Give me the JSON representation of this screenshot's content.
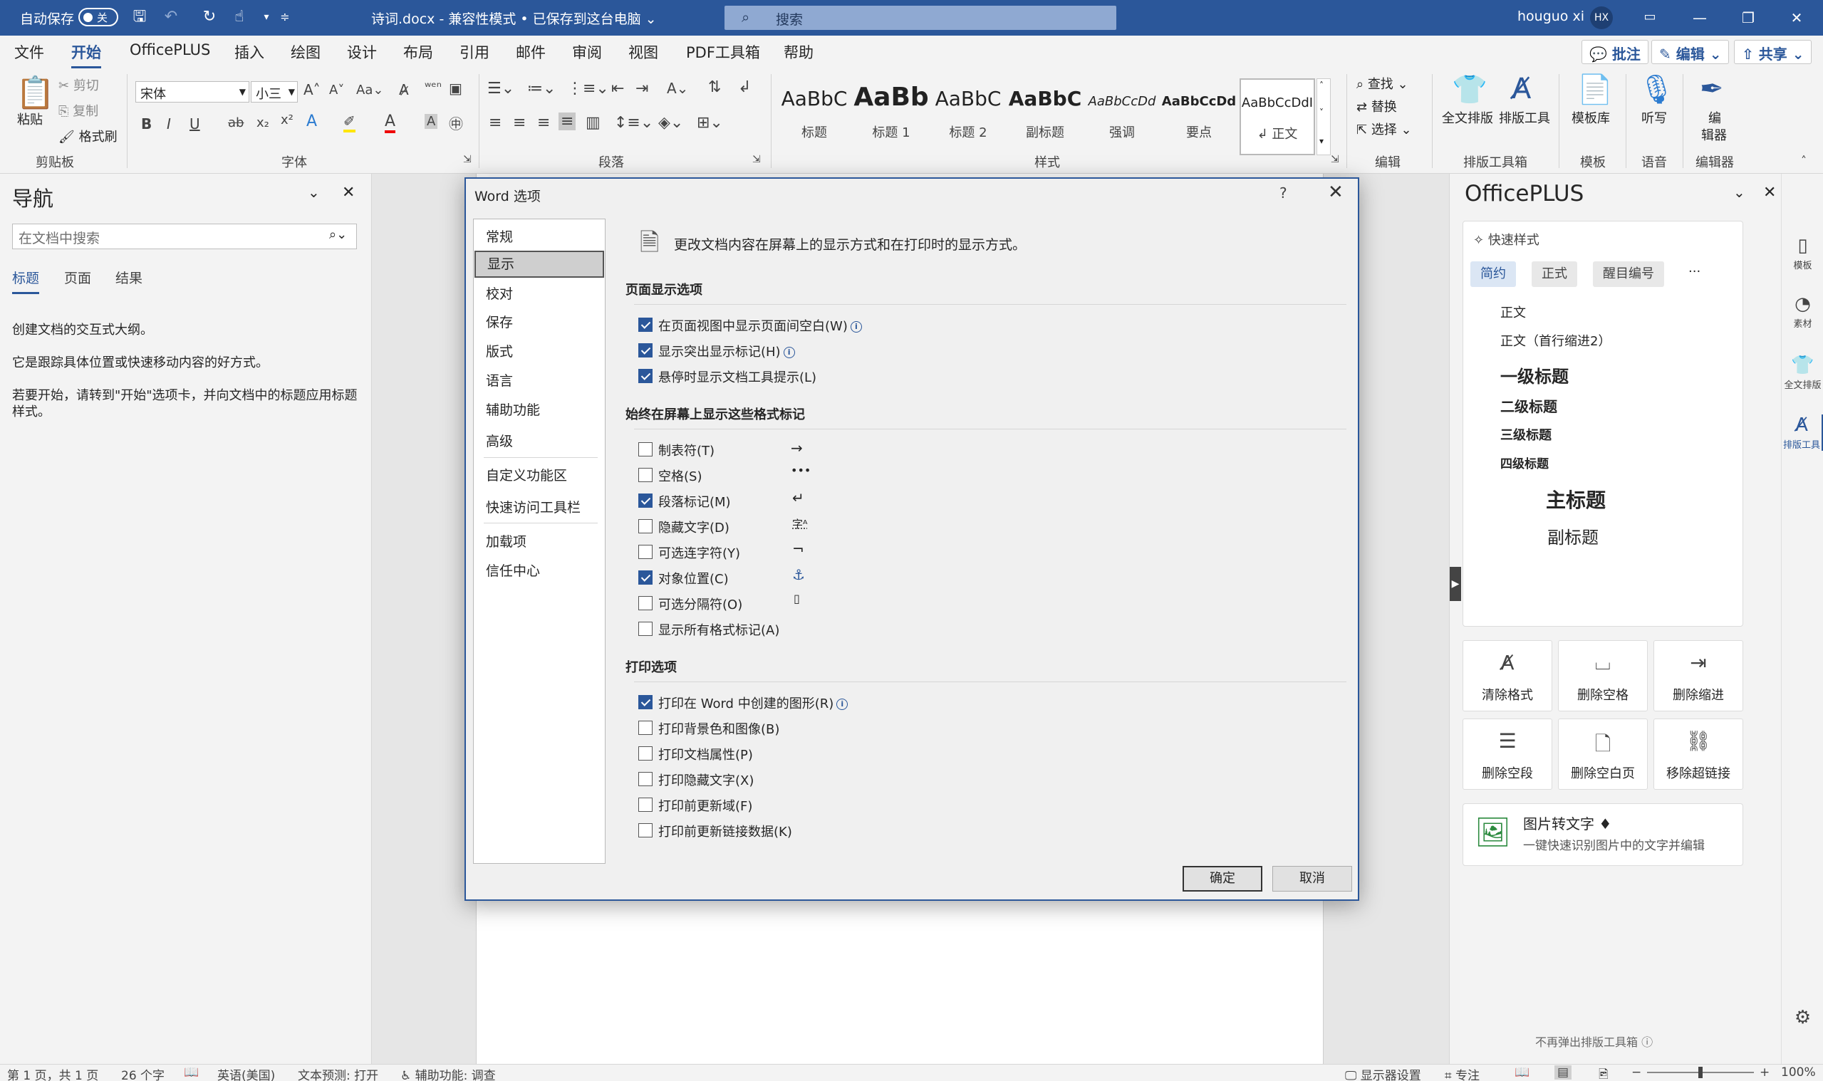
{
  "titlebar": {
    "autosave_label": "自动保存",
    "autosave_state": "关",
    "doc_title": "诗词.docx  -  兼容性模式 • 已保存到这台电脑 ⌄",
    "search_placeholder": "搜索",
    "user_name": "houguo xi",
    "user_initials": "HX",
    "accent_color": "#2b579a"
  },
  "tabs": [
    "文件",
    "开始",
    "OfficePLUS",
    "插入",
    "绘图",
    "设计",
    "布局",
    "引用",
    "邮件",
    "审阅",
    "视图",
    "PDF工具箱",
    "帮助"
  ],
  "active_tab": "开始",
  "ribbon_actions": {
    "comment": "批注",
    "edit": "编辑",
    "share": "共享"
  },
  "ribbon": {
    "clipboard": {
      "paste": "粘贴",
      "cut": "剪切",
      "copy": "复制",
      "format_painter": "格式刷",
      "group": "剪贴板"
    },
    "font": {
      "name": "宋体",
      "size": "小三",
      "group": "字体"
    },
    "paragraph": {
      "group": "段落"
    },
    "styles": {
      "items": [
        {
          "preview": "AaBbC",
          "name": "标题"
        },
        {
          "preview": "AaBb",
          "name": "标题 1"
        },
        {
          "preview": "AaBbC",
          "name": "标题 2"
        },
        {
          "preview": "AaBbC",
          "name": "副标题"
        },
        {
          "preview": "AaBbCcDd",
          "name": "强调"
        },
        {
          "preview": "AaBbCcDd",
          "name": "要点"
        },
        {
          "preview": "AaBbCcDdI",
          "name": "↲ 正文"
        }
      ],
      "group": "样式"
    },
    "editing": {
      "find": "查找",
      "replace": "替换",
      "select": "选择",
      "group": "编辑"
    },
    "layout_tools": {
      "full": "全文排版",
      "tools": "排版工具",
      "group": "排版工具箱"
    },
    "template": {
      "lib": "模板库",
      "group": "模板"
    },
    "voice": {
      "dictate": "听写",
      "group": "语音"
    },
    "editor": {
      "label": "编\n辑器",
      "label1": "编",
      "label2": "辑器",
      "group": "编辑器"
    }
  },
  "nav": {
    "title": "导航",
    "search_placeholder": "在文档中搜索",
    "tabs": [
      "标题",
      "页面",
      "结果"
    ],
    "active_tab": "标题",
    "lines": [
      "创建文档的交互式大纲。",
      "它是跟踪具体位置或快速移动内容的好方式。",
      "若要开始，请转到\"开始\"选项卡，并向文档中的标题应用标题样式。"
    ]
  },
  "dialog": {
    "title": "Word 选项",
    "help": "?",
    "categories": [
      "常规",
      "显示",
      "校对",
      "保存",
      "版式",
      "语言",
      "辅助功能",
      "高级",
      "自定义功能区",
      "快速访问工具栏",
      "加载项",
      "信任中心"
    ],
    "selected_category": "显示",
    "header_text": "更改文档内容在屏幕上的显示方式和在打印时的显示方式。",
    "page_display": {
      "heading": "页面显示选项",
      "options": [
        {
          "label": "在页面视图中显示页面间空白(W)",
          "checked": true,
          "info": true
        },
        {
          "label": "显示突出显示标记(H)",
          "checked": true,
          "info": true
        },
        {
          "label": "悬停时显示文档工具提示(L)",
          "checked": true,
          "info": false
        }
      ]
    },
    "format_marks": {
      "heading": "始终在屏幕上显示这些格式标记",
      "options": [
        {
          "label": "制表符(T)",
          "checked": false,
          "mark": "→"
        },
        {
          "label": "空格(S)",
          "checked": false,
          "mark": "•••"
        },
        {
          "label": "段落标记(M)",
          "checked": true,
          "mark": "↵"
        },
        {
          "label": "隐藏文字(D)",
          "checked": false,
          "mark": "字ᴬ"
        },
        {
          "label": "可选连字符(Y)",
          "checked": false,
          "mark": "¬"
        },
        {
          "label": "对象位置(C)",
          "checked": true,
          "mark": "⚓"
        },
        {
          "label": "可选分隔符(O)",
          "checked": false,
          "mark": "▯"
        },
        {
          "label": "显示所有格式标记(A)",
          "checked": false,
          "mark": ""
        }
      ]
    },
    "print": {
      "heading": "打印选项",
      "options": [
        {
          "label": "打印在 Word 中创建的图形(R)",
          "checked": true,
          "info": true
        },
        {
          "label": "打印背景色和图像(B)",
          "checked": false,
          "info": false
        },
        {
          "label": "打印文档属性(P)",
          "checked": false,
          "info": false
        },
        {
          "label": "打印隐藏文字(X)",
          "checked": false,
          "info": false
        },
        {
          "label": "打印前更新域(F)",
          "checked": false,
          "info": false
        },
        {
          "label": "打印前更新链接数据(K)",
          "checked": false,
          "info": false
        }
      ]
    },
    "ok": "确定",
    "cancel": "取消"
  },
  "officeplus": {
    "title": "OfficePLUS",
    "quick_styles": "快速样式",
    "filters": [
      "简约",
      "正式",
      "醒目编号",
      "···"
    ],
    "styles": [
      "正文",
      "正文（首行缩进2）",
      "一级标题",
      "二级标题",
      "三级标题",
      "四级标题",
      "主标题",
      "副标题"
    ],
    "tools": [
      {
        "icon": "clear-format",
        "label": "清除格式"
      },
      {
        "icon": "remove-space",
        "label": "删除空格"
      },
      {
        "icon": "remove-indent",
        "label": "删除缩进"
      },
      {
        "icon": "remove-empty-para",
        "label": "删除空段"
      },
      {
        "icon": "remove-blank-page",
        "label": "删除空白页"
      },
      {
        "icon": "remove-hyperlink",
        "label": "移除超链接"
      }
    ],
    "ocr_title": "图片转文字",
    "ocr_desc": "一键快速识别图片中的文字并编辑",
    "footer": "不再弹出排版工具箱",
    "strip": [
      {
        "icon": "template-icon",
        "label": "模板"
      },
      {
        "icon": "material-icon",
        "label": "素材"
      },
      {
        "icon": "layout-icon",
        "label": "全文排版"
      },
      {
        "icon": "tools-icon",
        "label": "排版工具"
      }
    ]
  },
  "status": {
    "page": "第 1 页，共 1 页",
    "words": "26 个字",
    "language": "英语(美国)",
    "prediction": "文本预测: 打开",
    "accessibility": "辅助功能: 调查",
    "display_settings": "显示器设置",
    "focus": "专注",
    "zoom": "100%"
  }
}
